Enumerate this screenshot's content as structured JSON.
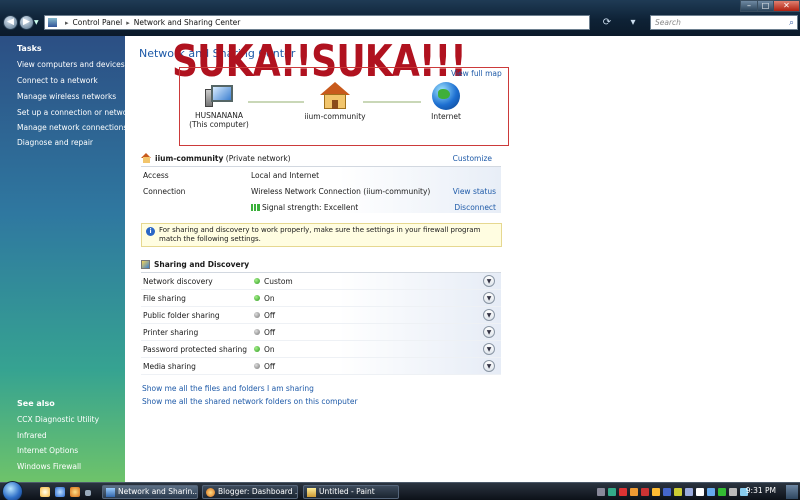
{
  "address": {
    "crumbs": [
      "Control Panel",
      "Network and Sharing Center"
    ],
    "search_placeholder": "Search"
  },
  "sidebar": {
    "tasks_heading": "Tasks",
    "tasks": [
      "View computers and devices",
      "Connect to a network",
      "Manage wireless networks",
      "Set up a connection or network",
      "Manage network connections",
      "Diagnose and repair"
    ],
    "see_also_heading": "See also",
    "see_also": [
      "CCX Diagnostic Utility",
      "Infrared",
      "Internet Options",
      "Windows Firewall"
    ]
  },
  "main": {
    "page_title": "Network and Sharing Center",
    "overlay_text": "SUKA!!SUKA!!!",
    "view_full_map": "View full map",
    "map_nodes": {
      "computer_name": "HUSNANANA",
      "computer_sub": "(This computer)",
      "network_name": "iium-community",
      "internet": "Internet"
    },
    "network": {
      "name": "iium-community",
      "type": "(Private network)",
      "customize": "Customize",
      "rows": [
        {
          "label": "Access",
          "value": "Local and Internet",
          "action": ""
        },
        {
          "label": "Connection",
          "value": "Wireless Network Connection (iium-community)",
          "action": "View status"
        },
        {
          "label": "",
          "value": "Signal strength:  Excellent",
          "action": "Disconnect"
        }
      ]
    },
    "info_message": "For sharing and discovery to work properly, make sure the settings in your firewall program match the following settings.",
    "sharing": {
      "heading": "Sharing and Discovery",
      "rows": [
        {
          "label": "Network discovery",
          "value": "Custom",
          "state": "on"
        },
        {
          "label": "File sharing",
          "value": "On",
          "state": "on"
        },
        {
          "label": "Public folder sharing",
          "value": "Off",
          "state": "off"
        },
        {
          "label": "Printer sharing",
          "value": "Off",
          "state": "off"
        },
        {
          "label": "Password protected sharing",
          "value": "On",
          "state": "on"
        },
        {
          "label": "Media sharing",
          "value": "Off",
          "state": "off"
        }
      ]
    },
    "links": [
      "Show me all the files and folders I am sharing",
      "Show me all the shared network folders on this computer"
    ]
  },
  "taskbar": {
    "tasks": [
      {
        "label": "Network and Sharin...",
        "icon": "network-window-icon"
      },
      {
        "label": "Blogger: Dashboard ...",
        "icon": "firefox-icon"
      },
      {
        "label": "Untitled - Paint",
        "icon": "paint-icon"
      }
    ],
    "clock": "9:31 PM"
  },
  "colors": {
    "link": "#1e5aa8",
    "overlay": "#b0121f",
    "map_border": "#cc3a3a"
  }
}
